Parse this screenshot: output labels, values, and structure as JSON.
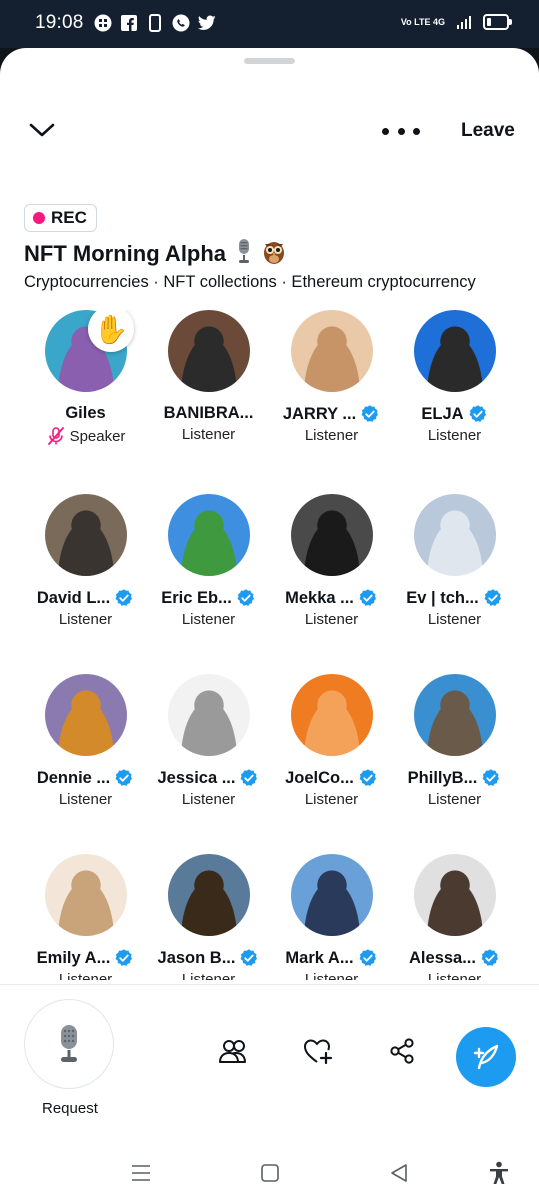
{
  "status_bar": {
    "time": "19:08",
    "icons": [
      "app-grid-icon",
      "facebook-icon",
      "phone-icon",
      "whatsapp-icon",
      "twitter-icon"
    ],
    "network": "Vo LTE 4G",
    "battery_level": 0.2
  },
  "header": {
    "leave_label": "Leave"
  },
  "space": {
    "rec_label": "REC",
    "title": "NFT Morning Alpha",
    "title_emojis": [
      "microphone",
      "owl"
    ],
    "topics": "Cryptocurrencies · NFT collections · Ethereum cryptocurrency"
  },
  "participants": [
    {
      "name": "Giles",
      "role": "Speaker",
      "verified": false,
      "muted": true,
      "hand_raised": true,
      "colors": [
        "#3aa6c9",
        "#8a5fb0"
      ]
    },
    {
      "name": "BANIBRA...",
      "role": "Listener",
      "verified": false,
      "colors": [
        "#6b4a3a",
        "#2b2b2b"
      ]
    },
    {
      "name": "JARRY ...",
      "role": "Listener",
      "verified": true,
      "colors": [
        "#e9c9a8",
        "#c79468"
      ]
    },
    {
      "name": "ELJA",
      "role": "Listener",
      "verified": true,
      "colors": [
        "#1e6fd8",
        "#2a2a2a"
      ]
    },
    {
      "name": "David L...",
      "role": "Listener",
      "verified": true,
      "colors": [
        "#7a6a5a",
        "#3a3430"
      ]
    },
    {
      "name": "Eric Eb...",
      "role": "Listener",
      "verified": true,
      "colors": [
        "#3f8fe0",
        "#3f9a3f"
      ]
    },
    {
      "name": "Mekka ...",
      "role": "Listener",
      "verified": true,
      "colors": [
        "#4a4a4a",
        "#1a1a1a"
      ]
    },
    {
      "name": "Ev | tch...",
      "role": "Listener",
      "verified": true,
      "colors": [
        "#b9c8da",
        "#dfe6ee"
      ]
    },
    {
      "name": "Dennie ...",
      "role": "Listener",
      "verified": true,
      "colors": [
        "#8a7ab0",
        "#d38a2b"
      ]
    },
    {
      "name": "Jessica ...",
      "role": "Listener",
      "verified": true,
      "colors": [
        "#f2f2f2",
        "#9a9a9a"
      ]
    },
    {
      "name": "JoelCo...",
      "role": "Listener",
      "verified": true,
      "colors": [
        "#f07c22",
        "#f4a25a"
      ]
    },
    {
      "name": "PhillyB...",
      "role": "Listener",
      "verified": true,
      "colors": [
        "#3a8fd0",
        "#6a5a4a"
      ]
    },
    {
      "name": "Emily A...",
      "role": "Listener",
      "verified": true,
      "colors": [
        "#f3e6d8",
        "#c9a47a"
      ]
    },
    {
      "name": "Jason B...",
      "role": "Listener",
      "verified": true,
      "colors": [
        "#5a7a9a",
        "#3a2a1a"
      ]
    },
    {
      "name": "Mark A...",
      "role": "Listener",
      "verified": true,
      "colors": [
        "#6aa0d8",
        "#2a3a5a"
      ]
    },
    {
      "name": "Alessa...",
      "role": "Listener",
      "verified": true,
      "colors": [
        "#e0e0e0",
        "#4a3a30"
      ]
    }
  ],
  "footer": {
    "request_label": "Request"
  },
  "colors": {
    "accent": "#1d9bf0",
    "rec_dot": "#f91880",
    "muted_mic": "#f91880"
  }
}
